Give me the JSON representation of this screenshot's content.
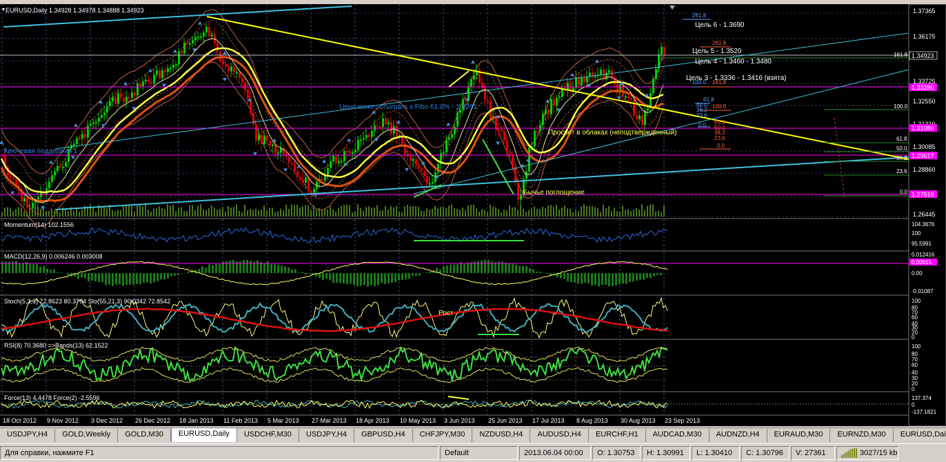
{
  "chart": {
    "title": "EURUSD,Daily  1.34928 1.34978 1.34888 1.34923",
    "price_labels": [
      "1.37365",
      "1.36175",
      "1.34923",
      "1.33725",
      "1.33280",
      "1.32550",
      "1.31310",
      "1.31080",
      "1.30085",
      "1.29617",
      "1.28860",
      "1.27516",
      "1.26445"
    ],
    "highlight_prices": {
      "current": "1.34923",
      "line1": "1.33280",
      "line2": "1.31080",
      "line3": "1.29617",
      "line4": "1.27516"
    },
    "annotations": {
      "target6": "Цель 6 - 1.3690",
      "target5": "Цель 5 - 1.3520",
      "target4": "Цель 4 - 1.3460 - 1.3480",
      "target3": "Цель 3 - 1.3336 - 1.3416 (взята)",
      "fibo_note": "Цена может отыграть к Fibo 61.8% - 1.3261",
      "cloud": "Просвет в облаках (неподтвержденный)",
      "support": "Ключевая поддержка 1",
      "bullish": "Бычье поглощение",
      "growth": "Рост"
    },
    "fib_levels_right": [
      "100.0",
      "61.8",
      "50.0",
      "38.2",
      "23.6",
      "0.0"
    ],
    "fib_levels_top": [
      "261.8",
      "261.8",
      "161.8",
      "100.0",
      "161.8"
    ],
    "fib_levels_mid": [
      "61.8",
      "50.0",
      "38.2",
      "23.6",
      "0.0",
      "100.0",
      "61.8",
      "50.0",
      "38.2",
      "23.6",
      "0.0"
    ],
    "date_labels": [
      "18 Oct 2012",
      "9 Nov 2012",
      "3 Dec 2012",
      "26 Dec 2012",
      "18 Jan 2013",
      "11 Feb 2013",
      "5 Mar 2013",
      "27 Mar 2013",
      "18 Apr 2013",
      "10 May 2013",
      "3 Jun 2013",
      "25 Jun 2013",
      "17 Jul 2013",
      "8 Aug 2013",
      "30 Aug 2013",
      "23 Sep 2013"
    ]
  },
  "indicators": {
    "momentum": {
      "label": "Momentum(14) 102.1556",
      "scale": [
        "104.3676",
        "100",
        "95.5991"
      ]
    },
    "macd": {
      "label": "MACD(12,26,9) 0.006246 0.003008",
      "scale": [
        "0.012416",
        "0.00615",
        "0.00",
        "-0.01087"
      ]
    },
    "stoch": {
      "label": "Stoch(5,3,3) 72.8623 80.3764  Sto(55,21,3) 90.0342 72.8542",
      "scale": [
        "100",
        "80",
        "70",
        "60",
        "40",
        "30",
        "20",
        "0"
      ]
    },
    "rsi": {
      "label": "RSI(8) 70.3680  =>Bands(13) 62.1522",
      "scale": [
        "100",
        "80",
        "70",
        "60",
        "40",
        "30",
        "20",
        "0"
      ]
    },
    "force": {
      "label": "Force(13) 4.4478  Force(2) -2.5596",
      "scale": [
        "137.374",
        "0",
        "-137.1821"
      ]
    }
  },
  "tabs": [
    "USDJPY,H4",
    "GOLD,Weekly",
    "GOLD,M30",
    "EURUSD,Daily",
    "USDCHF,M30",
    "USDJPY,H4",
    "GBPUSD,H4",
    "CHFJPY,M30",
    "NZDUSD,H4",
    "AUDUSD,H4",
    "EURCHF,H1",
    "AUDCAD,M30",
    "AUDNZD,H4",
    "EURAUD,M30",
    "EURNZD,M30",
    "EURUSD,Daily"
  ],
  "active_tab": 3,
  "status": {
    "help": "Для справки, нажмите F1",
    "profile": "Default",
    "datetime": "2013.06.04 00:00",
    "open": "O: 1.30753",
    "high": "H: 1.30991",
    "low": "L: 1.30410",
    "close": "C: 1.30796",
    "volume": "V: 27361",
    "traffic": "3027/15 kb"
  },
  "colors": {
    "bg": "#000000",
    "bull": "#00d000",
    "bear": "#e00000",
    "fibo": "#ffff00",
    "channel": "#40c0e0",
    "magenta": "#ff00ff"
  }
}
